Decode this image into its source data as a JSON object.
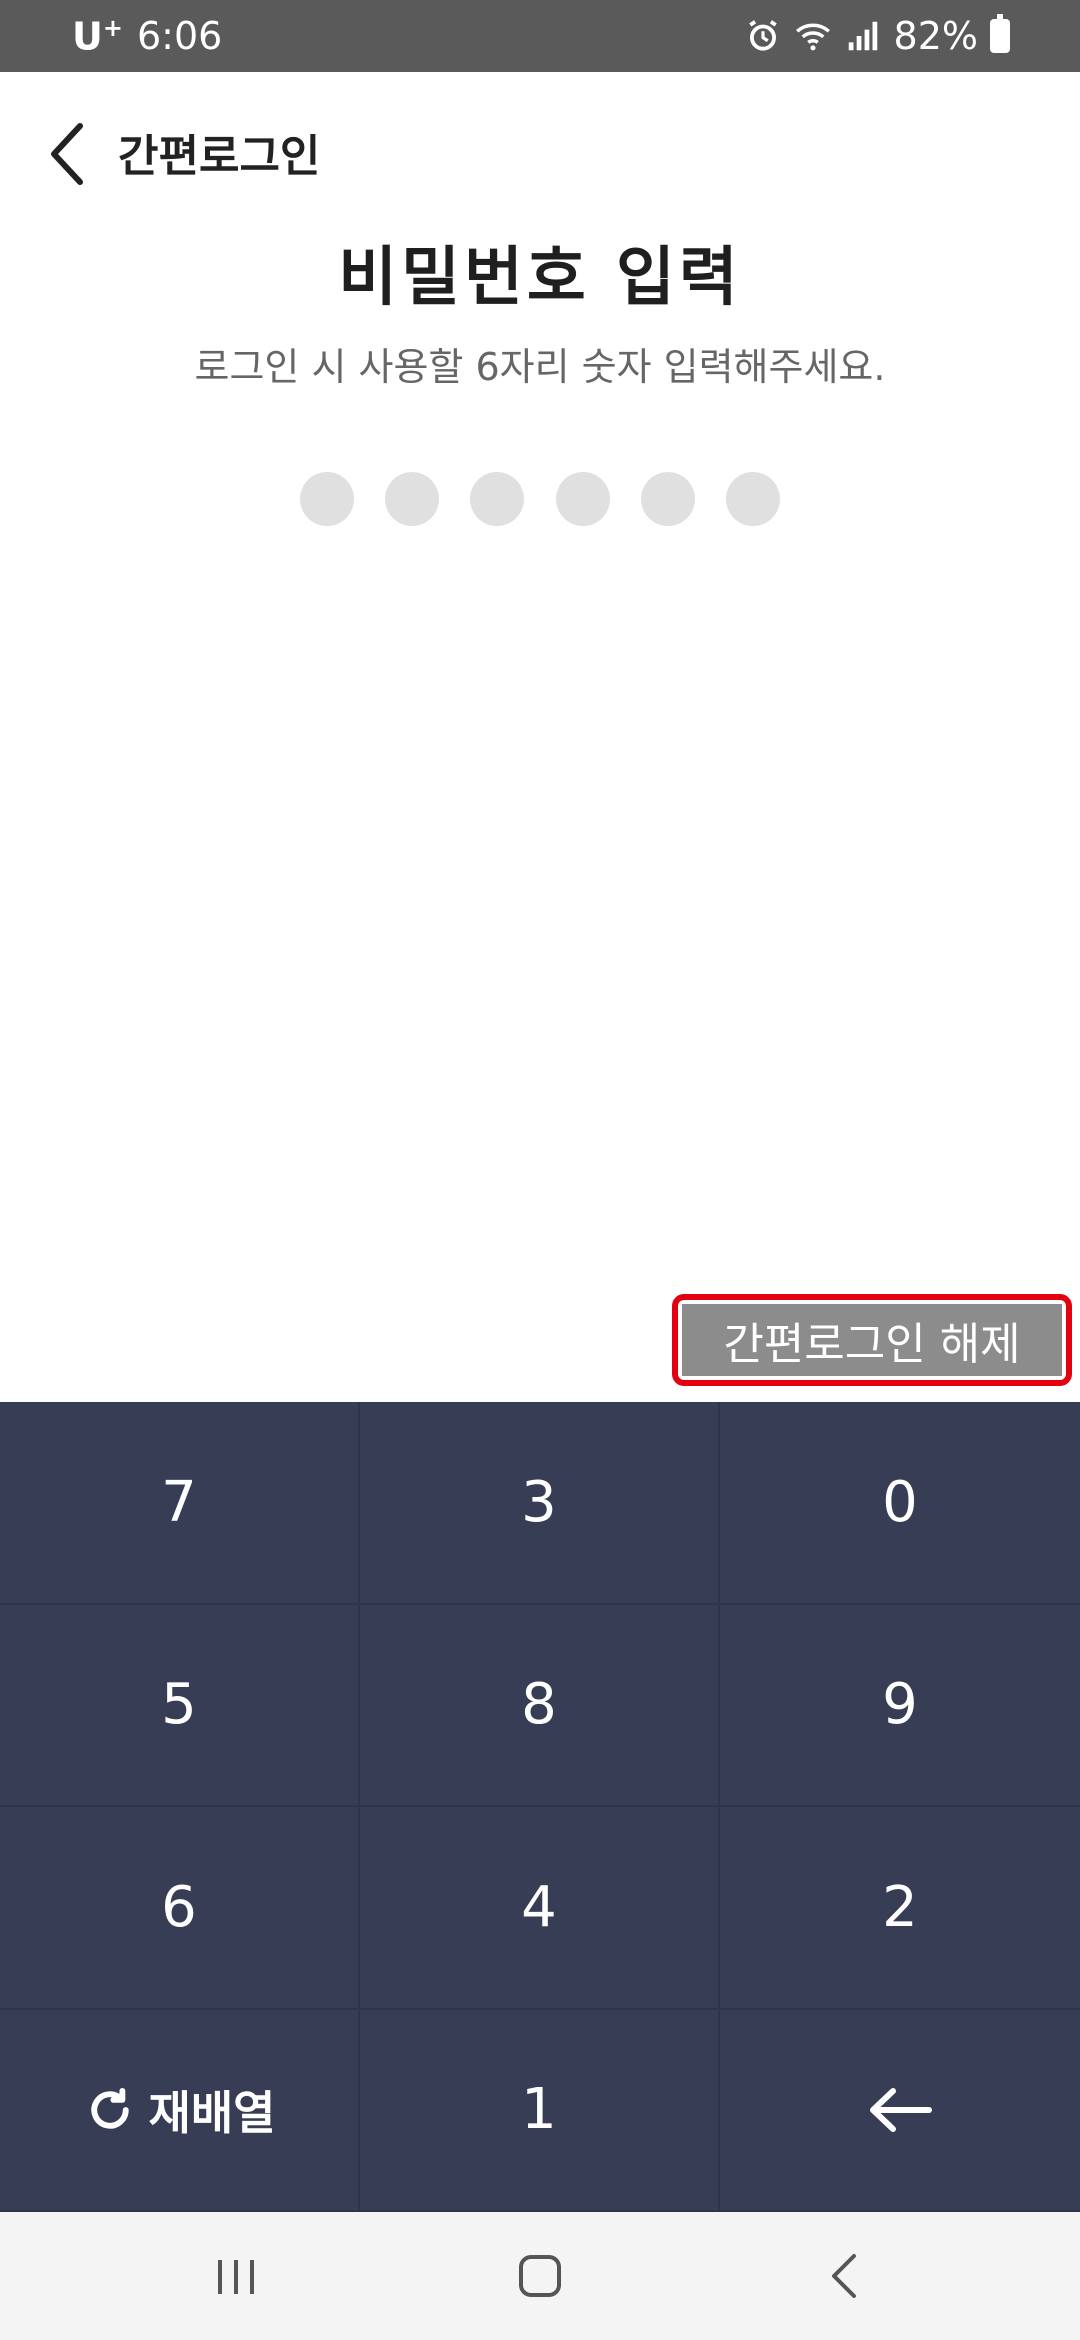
{
  "status_bar": {
    "carrier": "U",
    "carrier_sup": "+",
    "time": "6:06",
    "icons": [
      "alarm-icon",
      "wifi-icon",
      "signal-icon"
    ],
    "battery": "82%"
  },
  "header": {
    "back_icon": "chevron-left-icon",
    "title": "간편로그인"
  },
  "main": {
    "title": "비밀번호 입력",
    "subtitle": "로그인 시 사용할 6자리 숫자 입력해주세요.",
    "pin_length": 6,
    "pin_filled": 0,
    "release_button": "간편로그인 해제",
    "release_highlight_color": "#e3000f"
  },
  "keypad": {
    "keys": [
      "7",
      "3",
      "0",
      "5",
      "8",
      "9",
      "6",
      "4",
      "2"
    ],
    "shuffle_label": "재배열",
    "bottom_key": "1",
    "backspace_icon": "arrow-left-icon"
  },
  "nav_bar": {
    "icons": [
      "recent-apps-icon",
      "home-icon",
      "back-icon"
    ]
  },
  "colors": {
    "keypad_bg": "#363d55",
    "status_bar_bg": "#5a5a5a",
    "button_gray": "#8c8c8c"
  }
}
